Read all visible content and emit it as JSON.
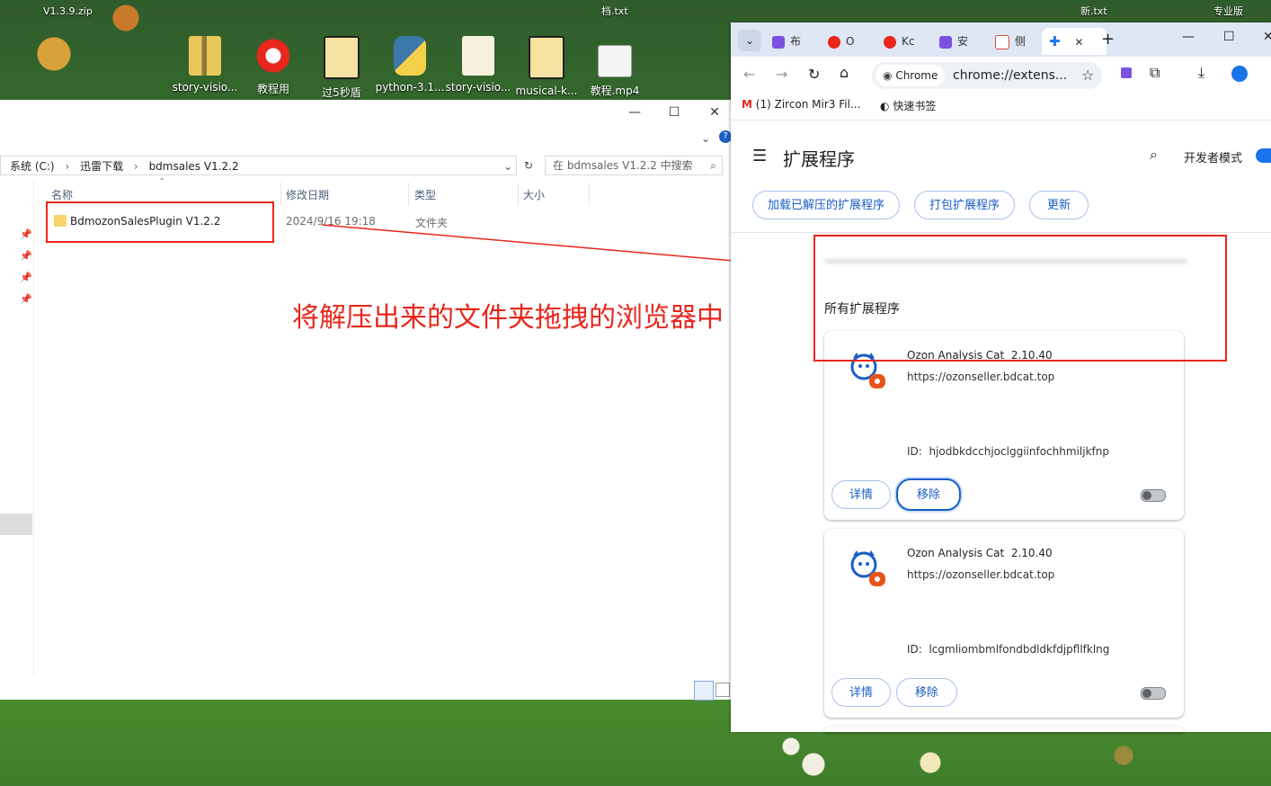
{
  "desktop": {
    "top_labels": [
      "V1.3.9.zip",
      "档.txt",
      "新.txt",
      "专业版"
    ],
    "icons": [
      {
        "label": "story-visio...",
        "type": "zip"
      },
      {
        "label": "教程用",
        "type": "app"
      },
      {
        "label": "过5秒盾",
        "type": "folder"
      },
      {
        "label": "python-3.1...",
        "type": "installer"
      },
      {
        "label": "story-visio...",
        "type": "folder"
      },
      {
        "label": "musical-k...",
        "type": "folder"
      },
      {
        "label": "教程.mp4",
        "type": "video"
      }
    ]
  },
  "explorer": {
    "breadcrumb": [
      "系统 (C:)",
      "迅雷下载",
      "bdmsales V1.2.2"
    ],
    "search_placeholder": "在 bdmsales V1.2.2 中搜索",
    "columns": [
      "名称",
      "修改日期",
      "类型",
      "大小"
    ],
    "rows": [
      {
        "name": "BdmozonSalesPlugin V1.2.2",
        "date": "2024/9/16 19:18",
        "type": "文件夹",
        "size": ""
      }
    ]
  },
  "annotation": "将解压出来的文件夹拖拽的浏览器中",
  "chrome": {
    "tabs": [
      {
        "label": "布",
        "color": "#7b52e0"
      },
      {
        "label": "O",
        "color": "#e8261c"
      },
      {
        "label": "Kc",
        "color": "#e8261c"
      },
      {
        "label": "安",
        "color": "#7b52e0"
      },
      {
        "label": "侧",
        "color": "#d4463a"
      },
      {
        "label": "",
        "color": "#1a73e8"
      }
    ],
    "omnibox_chip": "Chrome",
    "url": "chrome://extens...",
    "bookmarks": [
      {
        "label": "(1) Zircon Mir3 Fil...",
        "icon": "gmail-icon"
      },
      {
        "label": "快速书签",
        "icon": "bookmark-icon"
      }
    ],
    "page_title": "扩展程序",
    "dev_mode_label": "开发者模式",
    "actions": [
      "加载已解压的扩展程序",
      "打包扩展程序",
      "更新"
    ],
    "section_title": "所有扩展程序",
    "extensions": [
      {
        "name": "Ozon Analysis Cat",
        "version": "2.10.40",
        "url": "https://ozonseller.bdcat.top",
        "id_label": "ID:",
        "id": "hjodbkdcchjoclggiinfochhmiljkfnp",
        "details": "详情",
        "remove": "移除"
      },
      {
        "name": "Ozon Analysis Cat",
        "version": "2.10.40",
        "url": "https://ozonseller.bdcat.top",
        "id_label": "ID:",
        "id": "lcgmliombmlfondbdldkfdjpfllfklng",
        "details": "详情",
        "remove": "移除"
      }
    ]
  },
  "colors": {
    "accent": "#1a73e8",
    "annotation_red": "#e8261c"
  }
}
